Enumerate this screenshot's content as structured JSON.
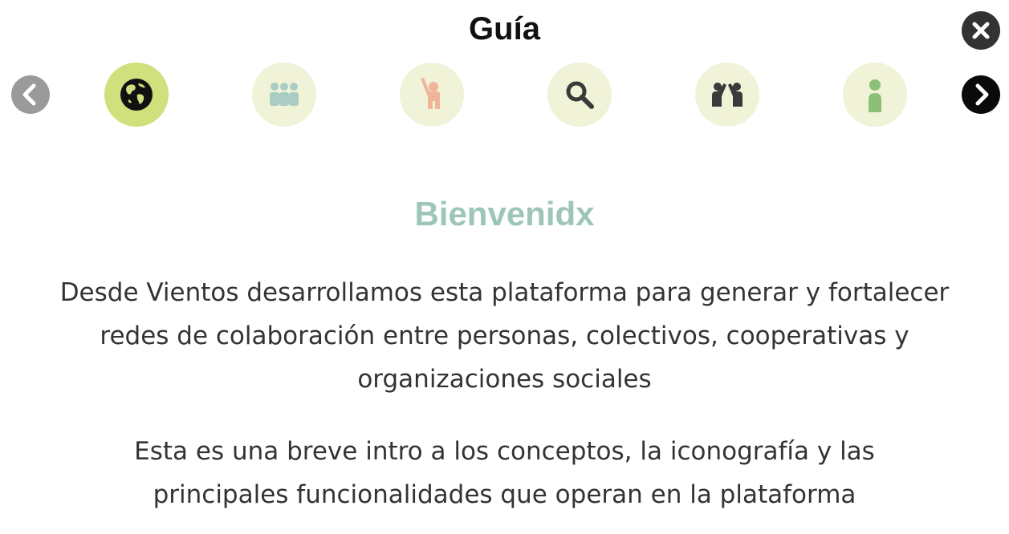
{
  "header": {
    "title": "Guía"
  },
  "controls": {
    "close_icon": "close-icon",
    "prev_icon": "chevron-left-icon",
    "next_icon": "chevron-right-icon"
  },
  "steps": [
    {
      "icon": "globe-icon",
      "active": true
    },
    {
      "icon": "group-icon",
      "active": false
    },
    {
      "icon": "raised-hand-person-icon",
      "active": false
    },
    {
      "icon": "search-icon",
      "active": false
    },
    {
      "icon": "collaboration-icon",
      "active": false
    },
    {
      "icon": "person-icon",
      "active": false
    }
  ],
  "colors": {
    "active_step": "#cfe07c",
    "inactive_step": "#f0f3d8",
    "heading": "#9ec6b8",
    "prev_button": "#9a9a9a",
    "next_button": "#0a0a0a",
    "close_button": "#333333"
  },
  "content": {
    "heading": "Bienvenidx",
    "paragraph1": "Desde Vientos desarrollamos esta plataforma para generar y fortalecer redes de colaboración entre personas, colectivos, cooperativas y organizaciones sociales",
    "paragraph2": "Esta es una breve intro a los conceptos, la iconografía y las principales funcionalidades que operan en la plataforma"
  }
}
